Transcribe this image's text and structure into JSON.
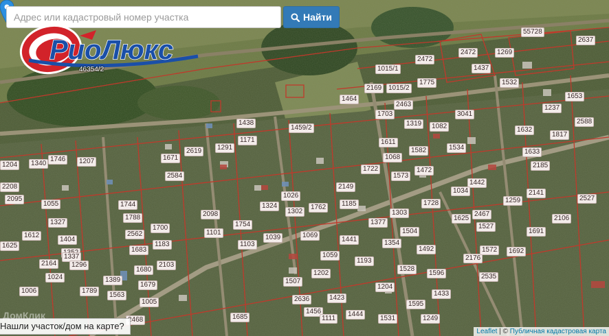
{
  "search": {
    "placeholder": "Адрес или кадастровый номер участка",
    "button_label": "Найти",
    "button_icon": "search-icon",
    "button_color": "#337ab7"
  },
  "logo": {
    "brand_text": "РиоЛюкс",
    "sub_label": "46354/2",
    "brand_color": "#1a4fa8",
    "accent_color": "#d2232a"
  },
  "map": {
    "marker_icon": "map-marker-icon",
    "marker_color": "#2c8fe0",
    "parcel_border_color": "#c0392b",
    "parcels": [
      "1426",
      "55728",
      "2472",
      "2472",
      "1269",
      "1437",
      "1015/1",
      "1015/2",
      "1775",
      "1532",
      "1464",
      "2169",
      "2463",
      "1703",
      "1319",
      "1082",
      "3041",
      "1237",
      "1653",
      "1438",
      "1459/2",
      "1171",
      "1611",
      "1582",
      "1534",
      "1632",
      "2588",
      "1817",
      "1291",
      "2619",
      "1671",
      "1207",
      "1204",
      "1746",
      "1340",
      "1068",
      "1722",
      "1472",
      "1633",
      "2185",
      "2584",
      "2208",
      "2149",
      "1573",
      "1442",
      "2141",
      "2527",
      "1744",
      "1026",
      "1762",
      "1185",
      "1034",
      "1259",
      "1055",
      "2095",
      "1788",
      "2098",
      "1324",
      "1302",
      "1377",
      "1303",
      "1728",
      "1625",
      "2467",
      "1527",
      "2106",
      "1612",
      "1327",
      "1700",
      "1101",
      "1754",
      "1039",
      "1069",
      "1441",
      "1504",
      "1691",
      "1404",
      "2562",
      "1183",
      "1103",
      "1354",
      "1352",
      "1492",
      "2176",
      "1572",
      "1692",
      "1625",
      "2164",
      "1337",
      "1683",
      "2103",
      "1296",
      "1059",
      "1193",
      "1202",
      "1528",
      "1596",
      "1680",
      "1389",
      "1024",
      "2535",
      "1679",
      "1507",
      "1204",
      "1563",
      "1006",
      "1789",
      "1005",
      "2636",
      "1423",
      "1433",
      "1595",
      "2468",
      "1685",
      "1456",
      "1111",
      "1444",
      "1531",
      "1249",
      "2637"
    ]
  },
  "footer": {
    "found_link": "Нашли участок/дом на карте?",
    "watermark": "ДомКлик",
    "attribution_leaflet": "Leaflet",
    "attribution_separator": "|",
    "attribution_copyright": "©",
    "attribution_source": "Публичная кадастровая карта"
  }
}
